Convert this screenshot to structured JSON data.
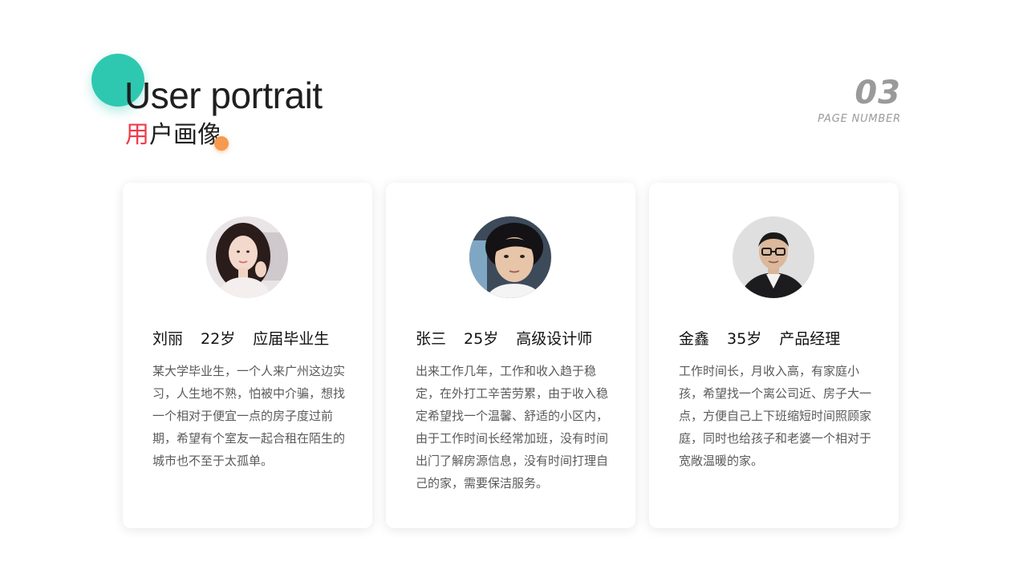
{
  "header": {
    "title_en": "User portrait",
    "title_cn_accent": "用",
    "title_cn_rest": "户画像",
    "page_number": "03",
    "page_label": "PAGE NUMBER"
  },
  "colors": {
    "teal": "#2ec8b0",
    "accent_red": "#ef3b4c",
    "orange": "#f59a4f",
    "muted_gray": "#9a9a9a"
  },
  "cards": [
    {
      "name": "刘丽",
      "age": "22岁",
      "role": "应届毕业生",
      "avatar": "woman-portrait",
      "description": "某大学毕业生，一个人来广州这边实习，人生地不熟，怕被中介骗，想找一个相对于便宜一点的房子度过前期，希望有个室友一起合租在陌生的城市也不至于太孤单。"
    },
    {
      "name": "张三",
      "age": "25岁",
      "role": "高级设计师",
      "avatar": "young-man-portrait",
      "description": "出来工作几年，工作和收入趋于稳定，在外打工辛苦劳累，由于收入稳定希望找一个温馨、舒适的小区内，由于工作时间长经常加班，没有时间出门了解房源信息，没有时间打理自己的家，需要保洁服务。"
    },
    {
      "name": "金鑫",
      "age": "35岁",
      "role": "产品经理",
      "avatar": "man-glasses-portrait",
      "description": "工作时间长，月收入高，有家庭小孩，希望找一个离公司近、房子大一点，方便自己上下班缩短时间照顾家庭，同时也给孩子和老婆一个相对于宽敞温暖的家。"
    }
  ]
}
